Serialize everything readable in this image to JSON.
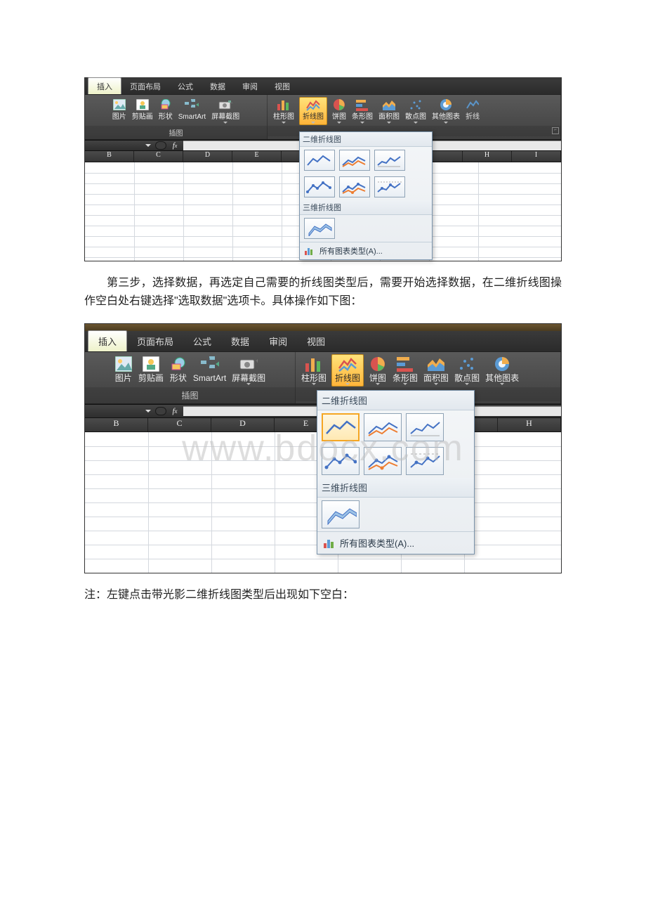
{
  "tabs": {
    "insert": "插入",
    "layout": "页面布局",
    "formula": "公式",
    "data": "数据",
    "review": "审阅",
    "view": "视图"
  },
  "ribbon": {
    "picture": "图片",
    "clipart": "剪贴画",
    "shapes": "形状",
    "smartart": "SmartArt",
    "screenshot": "屏幕截图",
    "illust_group": "插图",
    "column": "柱形图",
    "line": "折线图",
    "pie": "饼图",
    "bar": "条形图",
    "area": "面积图",
    "scatter": "散点图",
    "other": "其他图表",
    "other2": "其他图表",
    "line_cut": "折线"
  },
  "cols": {
    "B": "B",
    "C": "C",
    "D": "D",
    "E": "E",
    "H": "H",
    "I": "I"
  },
  "popup": {
    "hdr2d": "二维折线图",
    "hdr3d": "三维折线图",
    "all_types": "所有图表类型(A)..."
  },
  "para1": "第三步，选择数据，再选定自己需要的折线图类型后，需要开始选择数据，在二维折线图操作空白处右键选择\"选取数据\"选项卡。具体操作如下图：",
  "para2": "注：左键点击带光影二维折线图类型后出现如下空白：",
  "watermark": "www.bdocx.com"
}
